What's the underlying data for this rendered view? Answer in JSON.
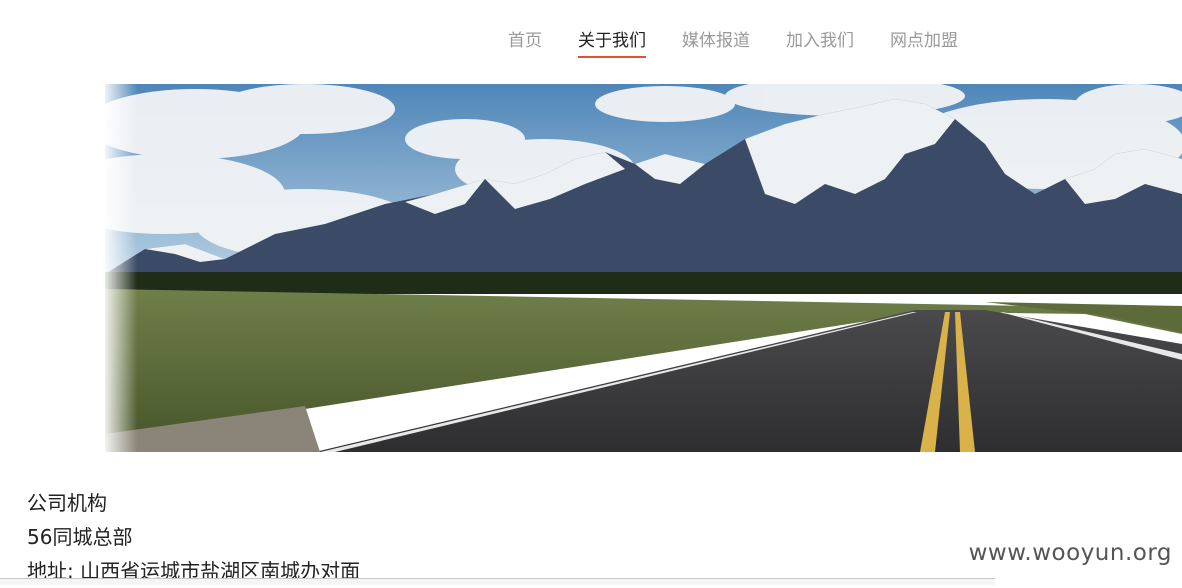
{
  "nav": {
    "items": [
      {
        "label": "首页",
        "active": false
      },
      {
        "label": "关于我们",
        "active": true
      },
      {
        "label": "媒体报道",
        "active": false
      },
      {
        "label": "加入我们",
        "active": false
      },
      {
        "label": "网点加盟",
        "active": false
      }
    ],
    "accent_color": "#e0532c"
  },
  "content": {
    "section_title": "公司机构",
    "branch_name": "56同城总部",
    "address": "地址: 山西省运城市盐湖区南城办对面"
  },
  "watermark": "www.wooyun.org"
}
